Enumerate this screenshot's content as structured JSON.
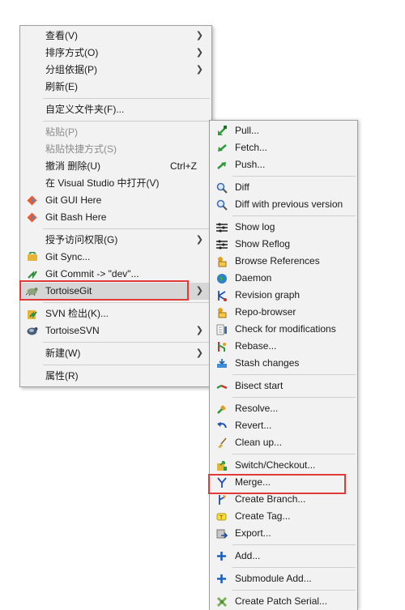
{
  "main_menu": {
    "view": "查看(V)",
    "sort": "排序方式(O)",
    "group": "分组依据(P)",
    "refresh": "刷新(E)",
    "customize": "自定义文件夹(F)...",
    "paste": "粘贴(P)",
    "paste_shortcut": "粘贴快捷方式(S)",
    "undo": "撤消 删除(U)",
    "undo_shortcut": "Ctrl+Z",
    "open_vs": "在 Visual Studio 中打开(V)",
    "git_gui": "Git GUI Here",
    "git_bash": "Git Bash Here",
    "grant_access": "授予访问权限(G)",
    "git_sync": "Git Sync...",
    "git_commit": "Git Commit -> \"dev\"...",
    "tortoisegit": "TortoiseGit",
    "svn_checkout": "SVN 检出(K)...",
    "tortoisesvn": "TortoiseSVN",
    "new": "新建(W)",
    "properties": "属性(R)"
  },
  "submenu": {
    "pull": "Pull...",
    "fetch": "Fetch...",
    "push": "Push...",
    "diff": "Diff",
    "diff_prev": "Diff with previous version",
    "show_log": "Show log",
    "show_reflog": "Show Reflog",
    "browse_refs": "Browse References",
    "daemon": "Daemon",
    "revision_graph": "Revision graph",
    "repo_browser": "Repo-browser",
    "check_mods": "Check for modifications",
    "rebase": "Rebase...",
    "stash": "Stash changes",
    "bisect": "Bisect start",
    "resolve": "Resolve...",
    "revert": "Revert...",
    "cleanup": "Clean up...",
    "switch": "Switch/Checkout...",
    "merge": "Merge...",
    "create_branch": "Create Branch...",
    "create_tag": "Create Tag...",
    "export": "Export...",
    "add": "Add...",
    "submodule_add": "Submodule Add...",
    "create_patch": "Create Patch Serial..."
  },
  "colors": {
    "highlight_border": "#e03a3a",
    "menu_bg": "#f2f2f2",
    "hover_bg": "#d6d6d6"
  }
}
